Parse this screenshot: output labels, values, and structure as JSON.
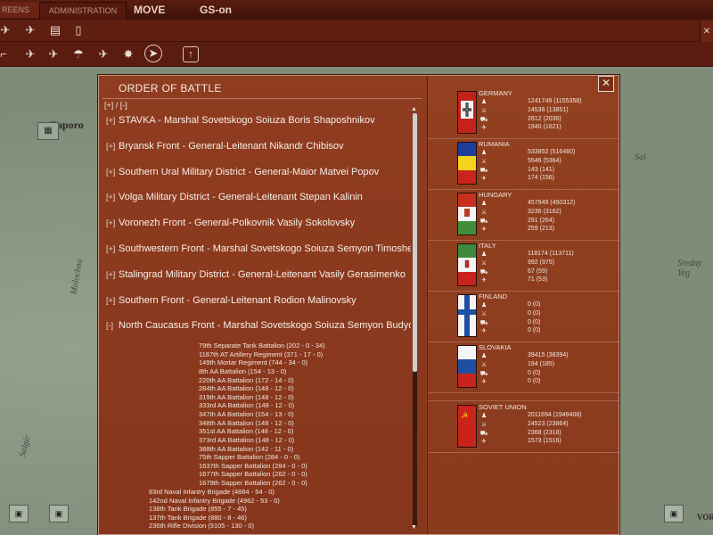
{
  "topbar": {
    "tab_screens": "REENS",
    "tab_administration": "ADMINISTRATION",
    "tab_move": "MOVE",
    "tab_gs": "GS-on"
  },
  "toolbar_icons": [
    "airplane-icon",
    "bomber-icon",
    "fuel-icon",
    "tablet-icon",
    "landing-icon",
    "paratrooper-icon",
    "plane-drop-icon",
    "fighter-icon",
    "burst-icon",
    "arrow-icon",
    "upload-icon"
  ],
  "map": {
    "labels": [
      "Zaporo",
      "Molochna",
      "Sal",
      "Sredny Yeg",
      "VOR",
      "Salgir"
    ]
  },
  "oob": {
    "title": "ORDER OF BATTLE",
    "expand_controls": "[+] / [-]",
    "fronts": [
      {
        "toggle": "[+]",
        "name": "STAVKA  -  Marshal Sovetskogo Soiuza Boris Shaposhnikov"
      },
      {
        "toggle": "[+]",
        "name": "Bryansk Front  -  General-Leitenant Nikandr Chibisov"
      },
      {
        "toggle": "[+]",
        "name": "Southern Ural Military District  -  General-Maior Matvei Popov"
      },
      {
        "toggle": "[+]",
        "name": "Volga Military District  -  General-Leitenant Stepan Kalinin"
      },
      {
        "toggle": "[+]",
        "name": "Voronezh Front  -  General-Polkovnik Vasily Sokolovsky"
      },
      {
        "toggle": "[+]",
        "name": "Southwestern Front  -  Marshal Sovetskogo Soiuza Semyon Timoshenko"
      },
      {
        "toggle": "[+]",
        "name": "Stalingrad Military District  -  General-Leitenant Vasily Gerasimenko"
      },
      {
        "toggle": "[+]",
        "name": "Southern Front  -  General-Leitenant Rodion Malinovsky"
      },
      {
        "toggle": "[-]",
        "name": "North Caucasus Front  -  Marshal Sovetskogo Soiuza Semyon Budyonny"
      }
    ],
    "units": [
      "79th Separate Tank Battalion  (202 - 0 - 34)",
      "1187th AT Artillery Regiment  (371 - 17 - 0)",
      "149th Mortar Regiment  (744 - 34 - 0)",
      "8th AA Battalion  (154 - 13 - 0)",
      "220th AA Battalion  (172 - 14 - 0)",
      "284th AA Battalion  (148 - 12 - 0)",
      "319th AA Battalion  (148 - 12 - 0)",
      "333rd AA Battalion  (148 - 12 - 0)",
      "347th AA Battalion  (154 - 13 - 0)",
      "348th AA Battalion  (148 - 12 - 0)",
      "351st AA Battalion  (148 - 12 - 0)",
      "373rd AA Battalion  (148 - 12 - 0)",
      "388th AA Battalion  (142 - 11 - 0)",
      "75th Sapper Battalion  (284 - 0 - 0)",
      "1637th Sapper Battalion  (284 - 0 - 0)",
      "1677th Sapper Battalion  (262 - 0 - 0)",
      "1679th Sapper Battalion  (262 - 0 - 0)",
      "83rd Naval Infantry Brigade  (4884 - 54 - 0)",
      "142nd Naval Infantry Brigade  (4962 - 53 - 0)",
      "136th Tank Brigade  (855 - 7 - 45)",
      "137th Tank Brigade  (880 - 8 - 46)",
      "236th Rifle Division  (9105 - 130 - 0)"
    ]
  },
  "nations": [
    {
      "name": "GERMANY",
      "flag": "germany",
      "men": "1241749 (1155358)",
      "guns": "14536 (13851)",
      "afv": "2612 (2036)",
      "aircraft": "1940 (1621)"
    },
    {
      "name": "RUMANIA",
      "flag": "rumania",
      "men": "533852 (516460)",
      "guns": "5546 (5364)",
      "afv": "143 (141)",
      "aircraft": "174 (156)"
    },
    {
      "name": "HUNGARY",
      "flag": "hungary",
      "men": "457949 (450312)",
      "guns": "3236 (3162)",
      "afv": "291 (264)",
      "aircraft": "259 (213)"
    },
    {
      "name": "ITALY",
      "flag": "italy",
      "men": "118174 (113711)",
      "guns": "992 (975)",
      "afv": "67 (59)",
      "aircraft": "71 (53)"
    },
    {
      "name": "FINLAND",
      "flag": "finland",
      "men": "0 (0)",
      "guns": "0 (0)",
      "afv": "0 (0)",
      "aircraft": "0 (0)"
    },
    {
      "name": "SLOVAKIA",
      "flag": "slovakia",
      "men": "39415 (38394)",
      "guns": "194 (185)",
      "afv": "0 (0)",
      "aircraft": "0 (0)"
    },
    {
      "name": "SOVIET UNION",
      "flag": "soviet",
      "men": "2011694 (1949408)",
      "guns": "24523 (23864)",
      "afv": "2368 (2318)",
      "aircraft": "1573 (1516)"
    }
  ],
  "colors": {
    "panel": "#8c3a1f",
    "topbar": "#4a160b",
    "map": "#7f8c7a"
  }
}
